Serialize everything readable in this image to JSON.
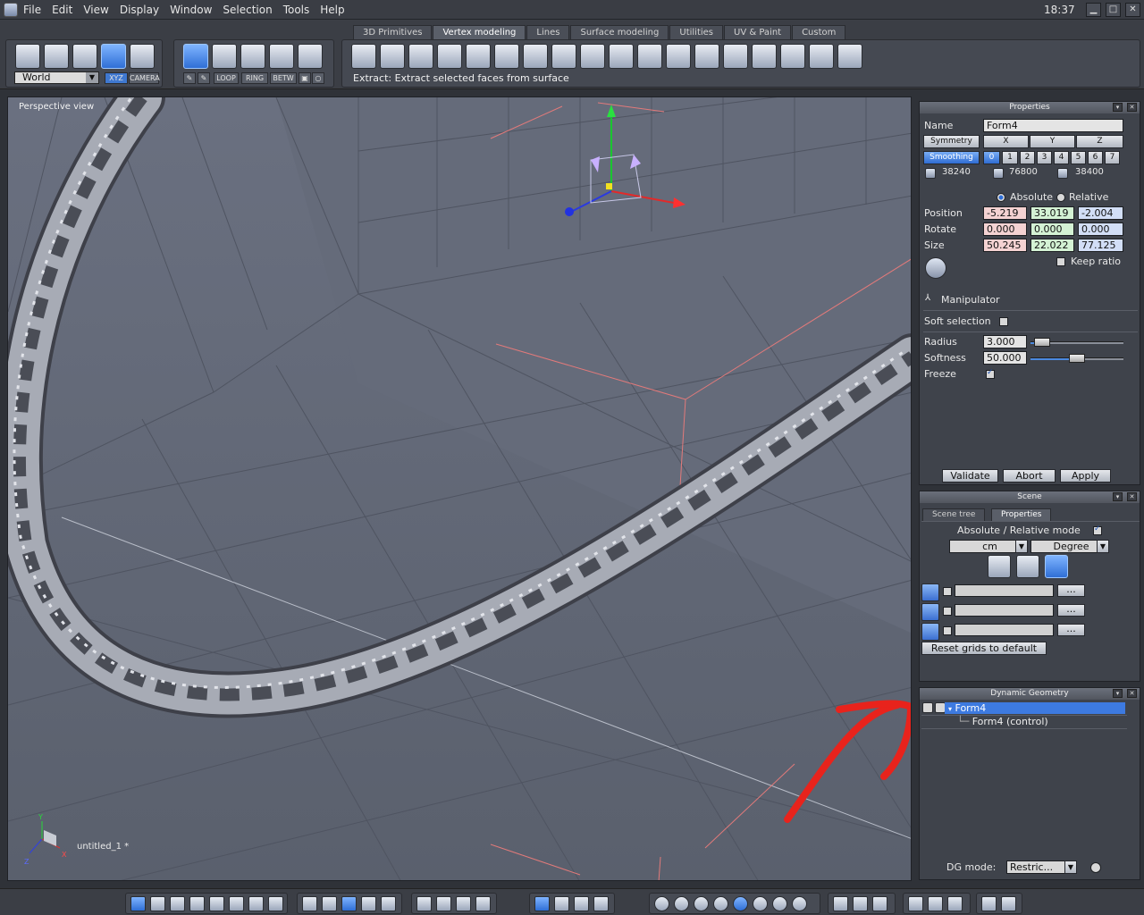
{
  "menubar": {
    "items": [
      "File",
      "Edit",
      "View",
      "Display",
      "Window",
      "Selection",
      "Tools",
      "Help"
    ],
    "clock": "18:37",
    "window_controls": [
      "minimize-icon",
      "maximize-icon",
      "close-icon"
    ]
  },
  "toolbar": {
    "space_select": "World",
    "mode_labels": [
      "XYZ",
      "CAMERA"
    ],
    "selection_modes": [
      "LOOP",
      "RING",
      "BETW"
    ],
    "tabs": [
      "3D Primitives",
      "Vertex modeling",
      "Lines",
      "Surface modeling",
      "Utilities",
      "UV & Paint",
      "Custom"
    ],
    "active_tab": "Vertex modeling",
    "hint": "Extract: Extract selected faces from surface"
  },
  "viewport": {
    "label": "Perspective view",
    "file": "untitled_1 *",
    "axes": [
      "Y",
      "X",
      "Z"
    ]
  },
  "properties": {
    "title": "Properties",
    "name_label": "Name",
    "name_value": "Form4",
    "symmetry_label": "Symmetry",
    "symmetry_axes": [
      "X",
      "Y",
      "Z"
    ],
    "smoothing_label": "Smoothing",
    "smoothing_levels": [
      "0",
      "1",
      "2",
      "3",
      "4",
      "5",
      "6",
      "7"
    ],
    "counts": [
      "38240",
      "76800",
      "38400"
    ],
    "absolute_label": "Absolute",
    "relative_label": "Relative",
    "position_label": "Position",
    "rotate_label": "Rotate",
    "size_label": "Size",
    "position": [
      "-5.219",
      "33.019",
      "-2.004"
    ],
    "rotate": [
      "0.000",
      "0.000",
      "0.000"
    ],
    "size": [
      "50.245",
      "22.022",
      "77.125"
    ],
    "keep_ratio": "Keep ratio",
    "manipulator": "Manipulator",
    "soft_selection": "Soft selection",
    "radius_label": "Radius",
    "radius": "3.000",
    "softness_label": "Softness",
    "softness": "50.000",
    "freeze_label": "Freeze",
    "validate": "Validate",
    "abort": "Abort",
    "apply": "Apply"
  },
  "scene": {
    "title": "Scene",
    "tabs": [
      "Scene tree",
      "Properties"
    ],
    "mode_label": "Absolute / Relative mode",
    "unit": "cm",
    "angle_unit": "Degree",
    "reset": "Reset grids to default",
    "ellipsis": "..."
  },
  "dynamic_geometry": {
    "title": "Dynamic Geometry",
    "items": [
      "Form4",
      "Form4 (control)"
    ],
    "mode_label": "DG mode:",
    "mode_value": "Restric..."
  },
  "colors": {
    "viewport_bg": "#5f6573",
    "selection_blue": "#3d7ae0",
    "annotation_red": "#e8231c"
  }
}
